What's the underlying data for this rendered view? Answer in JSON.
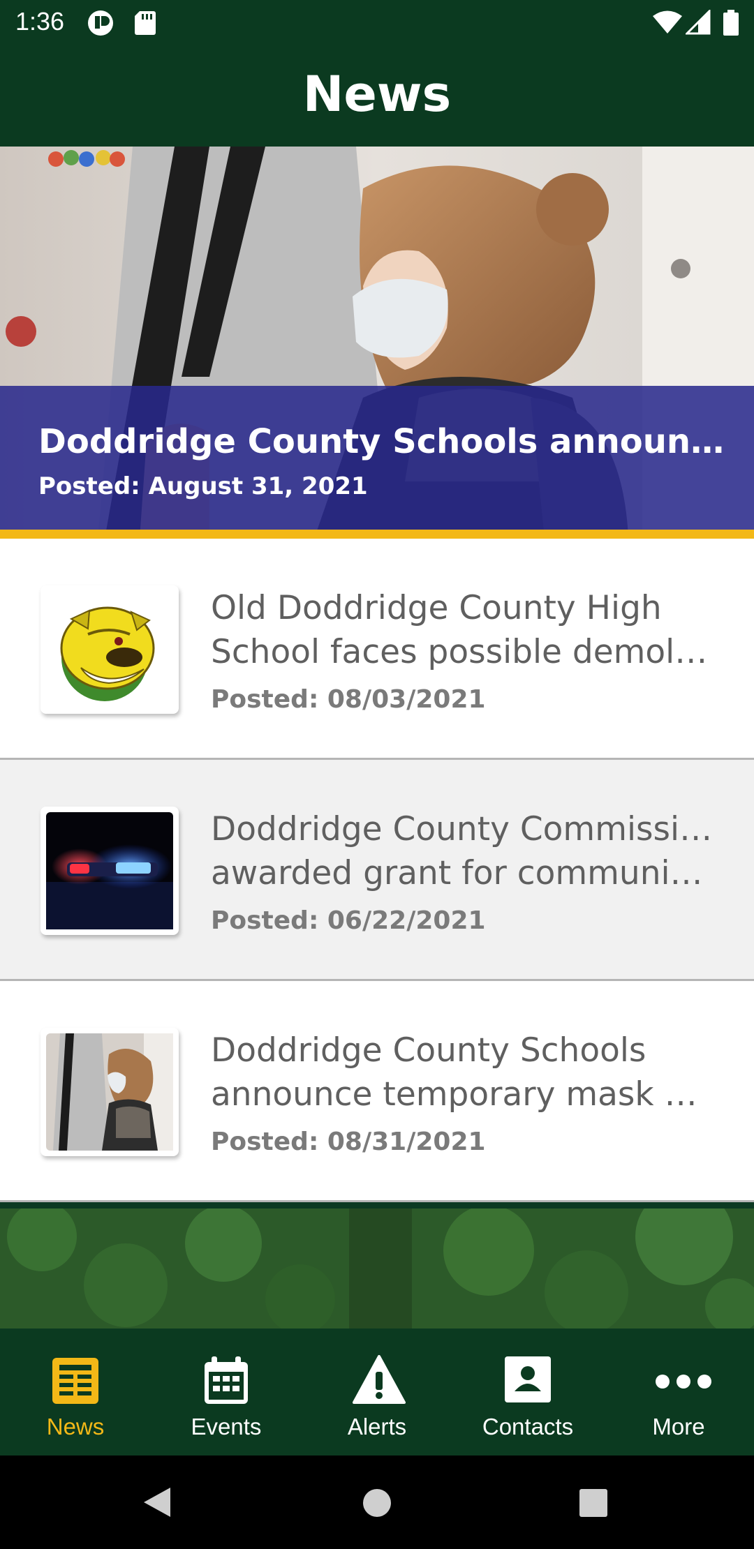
{
  "status_bar": {
    "time": "1:36",
    "icons": [
      "app-notification-icon",
      "sd-card-icon",
      "wifi-icon",
      "signal-icon",
      "battery-icon"
    ]
  },
  "header": {
    "title": "News"
  },
  "featured": {
    "title": "Doddridge County Schools announce te...",
    "date": "Posted: August 31, 2021"
  },
  "news_items": [
    {
      "title_line1": "Old Doddridge County High",
      "title_line2": "School faces possible demolition",
      "date": "Posted: 08/03/2021",
      "thumbnail": "bulldog-logo"
    },
    {
      "title_line1": "Doddridge County Commission",
      "title_line2": "awarded grant for community c...",
      "date": "Posted: 06/22/2021",
      "thumbnail": "police-lights-photo"
    },
    {
      "title_line1": "Doddridge County Schools",
      "title_line2": "announce temporary mask man...",
      "date": "Posted: 08/31/2021",
      "thumbnail": "masked-students-photo"
    }
  ],
  "bottom_nav": [
    {
      "label": "News",
      "icon": "newspaper-icon",
      "active": true
    },
    {
      "label": "Events",
      "icon": "calendar-icon",
      "active": false
    },
    {
      "label": "Alerts",
      "icon": "warning-icon",
      "active": false
    },
    {
      "label": "Contacts",
      "icon": "contact-card-icon",
      "active": false
    },
    {
      "label": "More",
      "icon": "more-dots-icon",
      "active": false
    }
  ],
  "colors": {
    "brand_green": "#0b3a20",
    "accent_gold": "#f3b817",
    "overlay_blue": "#28288c",
    "text_grey": "#5f5f5f"
  }
}
